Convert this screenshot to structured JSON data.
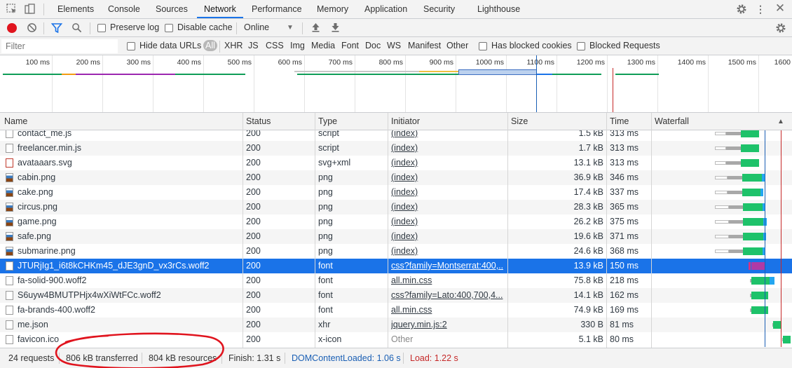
{
  "tabs": [
    "Elements",
    "Console",
    "Sources",
    "Network",
    "Performance",
    "Memory",
    "Application",
    "Security",
    "Lighthouse"
  ],
  "selected_tab": "Network",
  "toolbar": {
    "preserve_log": "Preserve log",
    "disable_cache": "Disable cache",
    "throttle": "Online"
  },
  "filterbar": {
    "placeholder": "Filter",
    "hide_data_urls": "Hide data URLs",
    "types": [
      "All",
      "XHR",
      "JS",
      "CSS",
      "Img",
      "Media",
      "Font",
      "Doc",
      "WS",
      "Manifest",
      "Other"
    ],
    "has_blocked_cookies": "Has blocked cookies",
    "blocked_requests": "Blocked Requests"
  },
  "overview_ticks": [
    "100 ms",
    "200 ms",
    "300 ms",
    "400 ms",
    "500 ms",
    "600 ms",
    "700 ms",
    "800 ms",
    "900 ms",
    "1000 ms",
    "1100 ms",
    "1200 ms",
    "1300 ms",
    "1400 ms",
    "1500 ms",
    "1600"
  ],
  "columns": [
    "Name",
    "Status",
    "Type",
    "Initiator",
    "Size",
    "Time",
    "Waterfall"
  ],
  "rows": [
    {
      "name": "contact_me.js",
      "status": "200",
      "type": "script",
      "initiator": "(index)",
      "size": "1.5 kB",
      "time": "313 ms",
      "icon": "js"
    },
    {
      "name": "freelancer.min.js",
      "status": "200",
      "type": "script",
      "initiator": "(index)",
      "size": "1.7 kB",
      "time": "313 ms",
      "icon": "js"
    },
    {
      "name": "avataaars.svg",
      "status": "200",
      "type": "svg+xml",
      "initiator": "(index)",
      "size": "13.1 kB",
      "time": "313 ms",
      "icon": "svg"
    },
    {
      "name": "cabin.png",
      "status": "200",
      "type": "png",
      "initiator": "(index)",
      "size": "36.9 kB",
      "time": "346 ms",
      "icon": "img"
    },
    {
      "name": "cake.png",
      "status": "200",
      "type": "png",
      "initiator": "(index)",
      "size": "17.4 kB",
      "time": "337 ms",
      "icon": "img"
    },
    {
      "name": "circus.png",
      "status": "200",
      "type": "png",
      "initiator": "(index)",
      "size": "28.3 kB",
      "time": "365 ms",
      "icon": "img"
    },
    {
      "name": "game.png",
      "status": "200",
      "type": "png",
      "initiator": "(index)",
      "size": "26.2 kB",
      "time": "375 ms",
      "icon": "img"
    },
    {
      "name": "safe.png",
      "status": "200",
      "type": "png",
      "initiator": "(index)",
      "size": "19.6 kB",
      "time": "371 ms",
      "icon": "img"
    },
    {
      "name": "submarine.png",
      "status": "200",
      "type": "png",
      "initiator": "(index)",
      "size": "24.6 kB",
      "time": "368 ms",
      "icon": "img"
    },
    {
      "name": "JTURjIg1_i6t8kCHKm45_dJE3gnD_vx3rCs.woff2",
      "status": "200",
      "type": "font",
      "initiator": "css?family=Montserrat:400,...",
      "size": "13.9 kB",
      "time": "150 ms",
      "icon": "file"
    },
    {
      "name": "fa-solid-900.woff2",
      "status": "200",
      "type": "font",
      "initiator": "all.min.css",
      "size": "75.8 kB",
      "time": "218 ms",
      "icon": "file"
    },
    {
      "name": "S6uyw4BMUTPHjx4wXiWtFCc.woff2",
      "status": "200",
      "type": "font",
      "initiator": "css?family=Lato:400,700,4...",
      "size": "14.1 kB",
      "time": "162 ms",
      "icon": "file"
    },
    {
      "name": "fa-brands-400.woff2",
      "status": "200",
      "type": "font",
      "initiator": "all.min.css",
      "size": "74.9 kB",
      "time": "169 ms",
      "icon": "file"
    },
    {
      "name": "me.json",
      "status": "200",
      "type": "xhr",
      "initiator": "jquery.min.js:2",
      "size": "330 B",
      "time": "81 ms",
      "icon": "file"
    },
    {
      "name": "favicon.ico",
      "status": "200",
      "type": "x-icon",
      "initiator": "Other",
      "size": "5.1 kB",
      "time": "80 ms",
      "icon": "file"
    }
  ],
  "selected_row": 9,
  "status": {
    "requests": "24 requests",
    "transferred": "806 kB transferred",
    "resources": "804 kB resources",
    "finish": "Finish: 1.31 s",
    "dcl": "DOMContentLoaded: 1.06 s",
    "load": "Load: 1.22 s"
  },
  "colors": {
    "accent": "#1a73e8",
    "dcl": "#1a5fb4",
    "load": "#c62828",
    "annotation": "#e0141e"
  }
}
